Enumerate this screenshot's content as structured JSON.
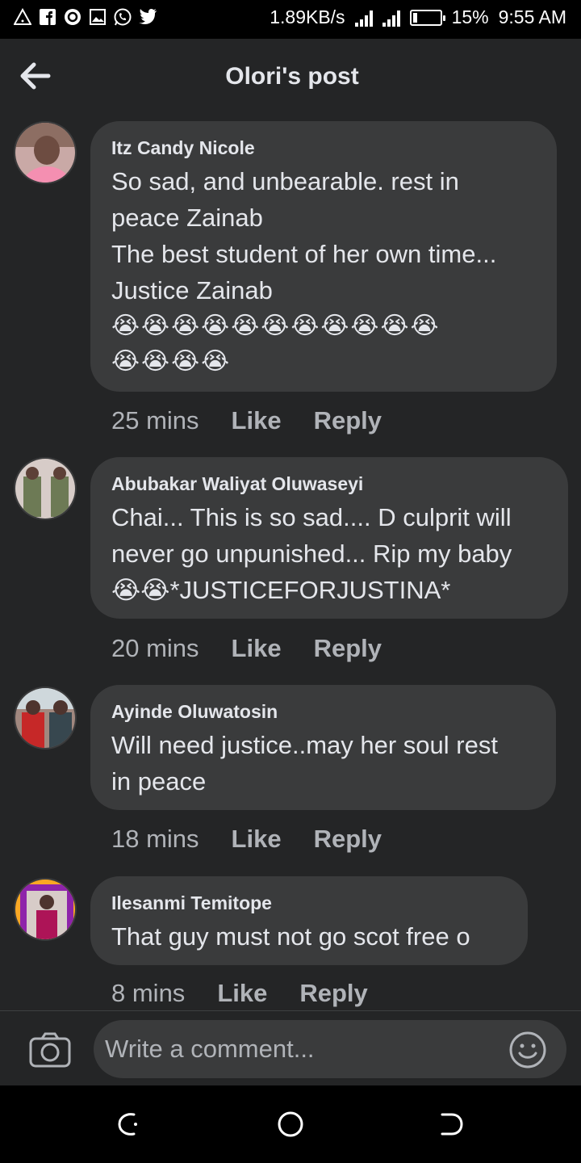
{
  "status_bar": {
    "left_icons": [
      "alert-icon",
      "facebook-icon",
      "opera-icon",
      "gallery-icon",
      "whatsapp-icon",
      "twitter-icon"
    ],
    "speed": "1.89KB/s",
    "battery_percent": "15%",
    "battery_level": 0.15,
    "time": "9:55 AM"
  },
  "header": {
    "title": "Olori's post"
  },
  "comments": [
    {
      "name": "Itz Candy Nicole",
      "text": "So sad, and unbearable. rest in\npeace Zainab\nThe best student of her own time...\nJustice Zainab",
      "emojis": [
        "😭😭😭😭😭😭😭😭😭😭😭",
        "😭😭😭😭"
      ],
      "time": "25 mins",
      "like": "Like",
      "reply": "Reply"
    },
    {
      "name": "Abubakar Waliyat Oluwaseyi",
      "text": "Chai... This is so sad.... D culprit will\nnever go unpunished... Rip my baby",
      "emoji_line": "😭😭*JUSTICEFORJUSTINA*",
      "time": "20 mins",
      "like": "Like",
      "reply": "Reply"
    },
    {
      "name": "Ayinde Oluwatosin",
      "text": "Will need justice..may her soul rest\nin peace",
      "time": "18 mins",
      "like": "Like",
      "reply": "Reply"
    },
    {
      "name": "Ilesanmi Temitope",
      "text": "That guy must not go scot free o",
      "time": "8 mins",
      "like": "Like",
      "reply": "Reply"
    }
  ],
  "composer": {
    "placeholder": "Write a comment..."
  },
  "colors": {
    "background": "#242526",
    "bubble": "#3a3b3c",
    "text": "#e4e6eb",
    "muted": "#b0b3b8"
  }
}
